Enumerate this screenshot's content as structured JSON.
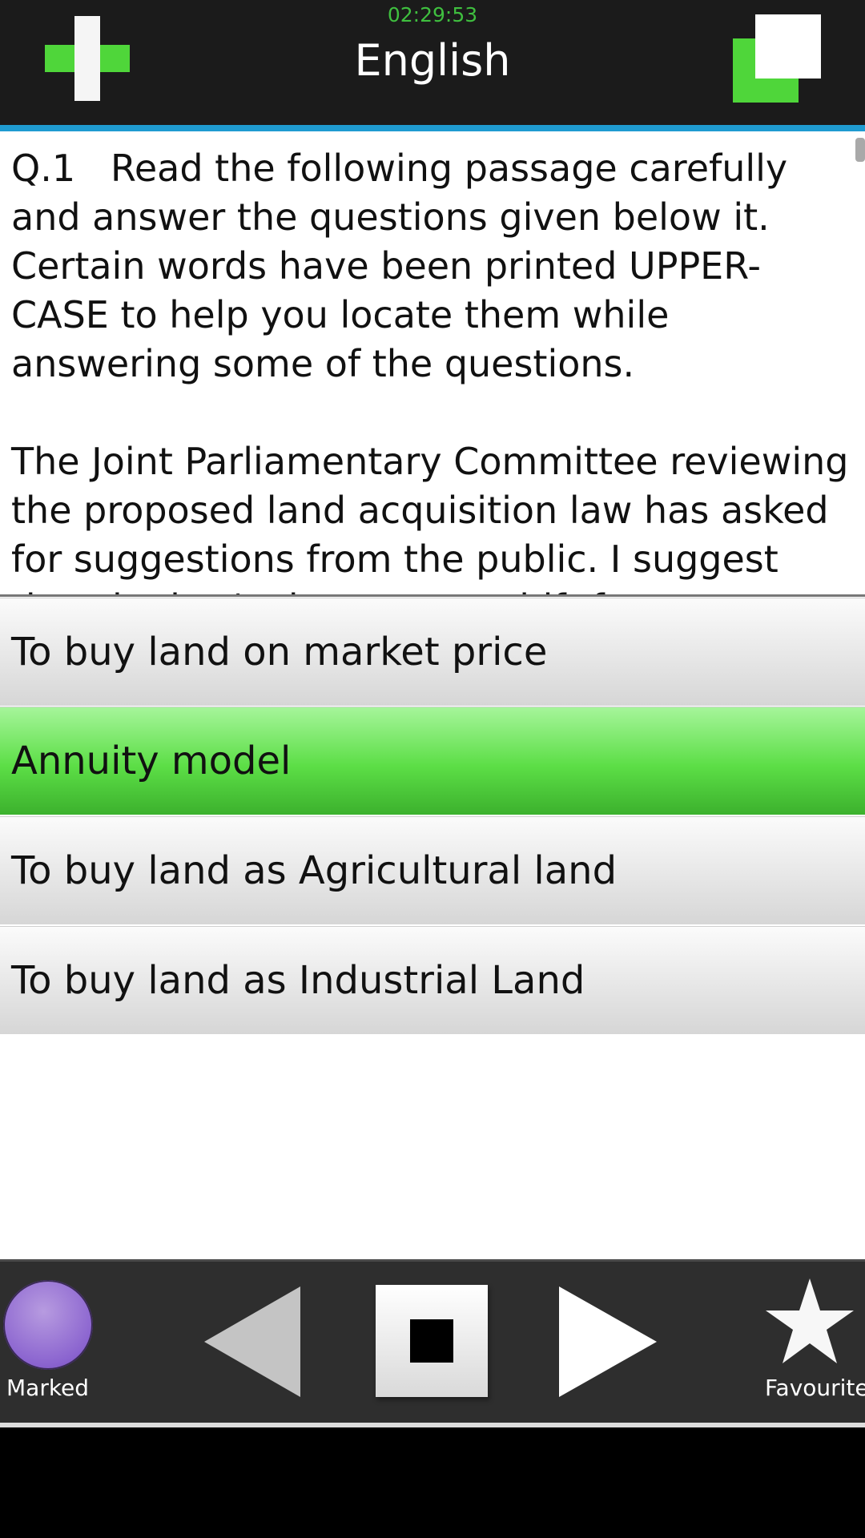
{
  "header": {
    "timer": "02:29:53",
    "title": "English",
    "timer_color": "#3fbf3f",
    "accent_line_color": "#1f9bd1"
  },
  "question": {
    "text": "Q.1   Read the following passage carefully and answer the questions given below it. Certain words have been printed UPPER-CASE to help you locate them while answering some of the questions.\n\nThe Joint Parliamentary Committee reviewing the proposed land acquisition law has asked for suggestions from the public. I suggest that the law's thrust must shift from compulsory acquisition"
  },
  "options": [
    {
      "label": "To buy land on market price",
      "selected": false
    },
    {
      "label": "Annuity model",
      "selected": true
    },
    {
      "label": "To buy land as Agricultural land",
      "selected": false
    },
    {
      "label": "To buy land as Industrial Land",
      "selected": false
    }
  ],
  "bottom_nav": {
    "marked_label": "Marked",
    "favourite_label": "Favourite",
    "icons": [
      "marked-circle-icon",
      "prev-triangle-icon",
      "stop-icon",
      "next-triangle-icon",
      "star-icon"
    ]
  }
}
